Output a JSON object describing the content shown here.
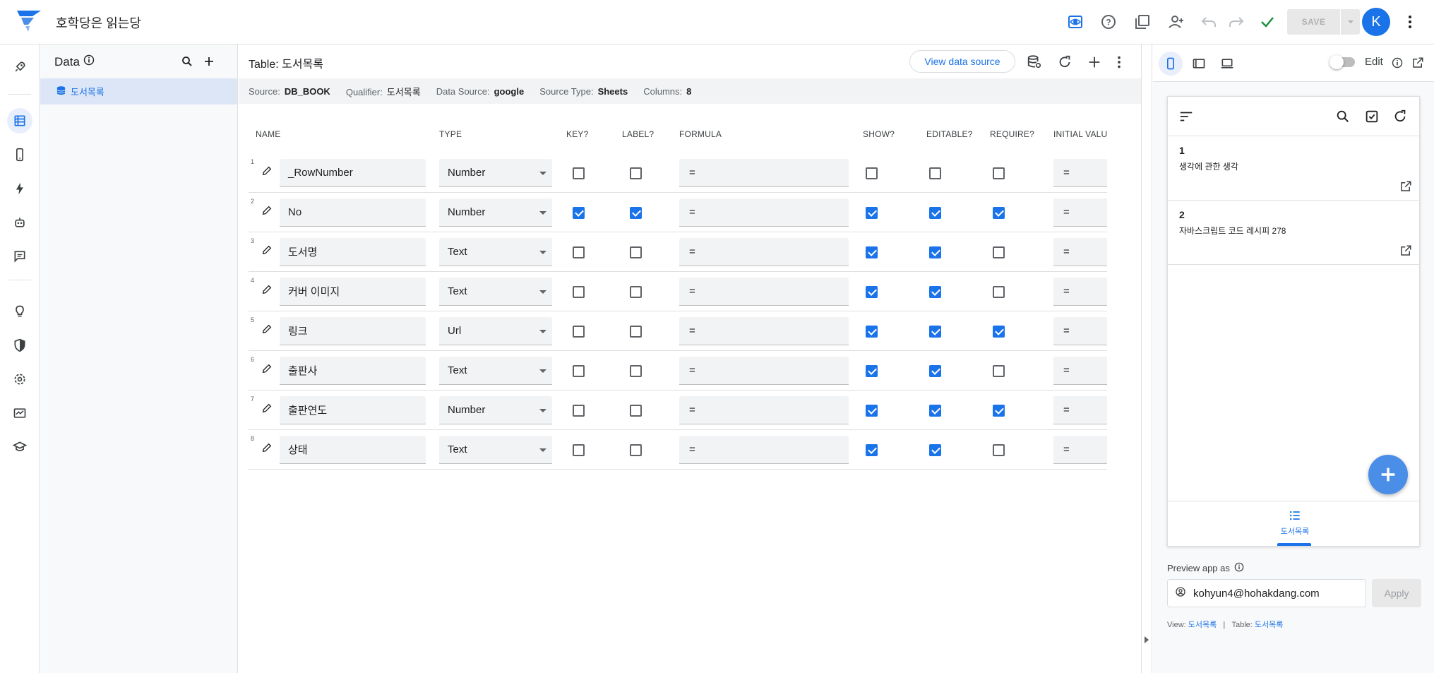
{
  "app": {
    "title": "호학당은 읽는당",
    "avatar_letter": "K",
    "save_label": "SAVE"
  },
  "colors": {
    "accent": "#1a73e8",
    "check_green": "#1e8e3e",
    "fab": "#4a8ee8"
  },
  "topbar_icons": [
    "preview-icon",
    "help-icon",
    "copy-app-icon",
    "share-icon",
    "undo-icon",
    "redo-icon",
    "check-icon",
    "more-vert-icon"
  ],
  "rail_icons": [
    "rocket-icon",
    "data-icon",
    "mobile-icon",
    "automation-icon",
    "bot-icon",
    "chat-icon",
    "lightbulb-icon",
    "security-icon",
    "settings-icon",
    "monitor-icon",
    "learn-icon"
  ],
  "data_panel": {
    "header": "Data",
    "tables": [
      "도서목록"
    ]
  },
  "main": {
    "title": "Table: 도서목록",
    "view_source_label": "View data source",
    "meta": [
      {
        "label": "Source:",
        "value": "DB_BOOK"
      },
      {
        "label": "Qualifier:",
        "value": "도서목록"
      },
      {
        "label": "Data Source:",
        "value": "google"
      },
      {
        "label": "Source Type:",
        "value": "Sheets"
      },
      {
        "label": "Columns:",
        "value": "8"
      }
    ],
    "columns": [
      "NAME",
      "TYPE",
      "KEY?",
      "LABEL?",
      "FORMULA",
      "SHOW?",
      "EDITABLE?",
      "REQUIRE?",
      "INITIAL VALUE"
    ],
    "rows": [
      {
        "num": "1",
        "name": "_RowNumber",
        "type": "Number",
        "key": false,
        "label": false,
        "formula": "=",
        "show": false,
        "editable": false,
        "require": false,
        "initial": "="
      },
      {
        "num": "2",
        "name": "No",
        "type": "Number",
        "key": true,
        "label": true,
        "formula": "=",
        "show": true,
        "editable": true,
        "require": true,
        "initial": "="
      },
      {
        "num": "3",
        "name": "도서명",
        "type": "Text",
        "key": false,
        "label": false,
        "formula": "=",
        "show": true,
        "editable": true,
        "require": false,
        "initial": "="
      },
      {
        "num": "4",
        "name": "커버 이미지",
        "type": "Text",
        "key": false,
        "label": false,
        "formula": "=",
        "show": true,
        "editable": true,
        "require": false,
        "initial": "="
      },
      {
        "num": "5",
        "name": "링크",
        "type": "Url",
        "key": false,
        "label": false,
        "formula": "=",
        "show": true,
        "editable": true,
        "require": true,
        "initial": "="
      },
      {
        "num": "6",
        "name": "출판사",
        "type": "Text",
        "key": false,
        "label": false,
        "formula": "=",
        "show": true,
        "editable": true,
        "require": false,
        "initial": "="
      },
      {
        "num": "7",
        "name": "출판연도",
        "type": "Number",
        "key": false,
        "label": false,
        "formula": "=",
        "show": true,
        "editable": true,
        "require": true,
        "initial": "="
      },
      {
        "num": "8",
        "name": "상태",
        "type": "Text",
        "key": false,
        "label": false,
        "formula": "=",
        "show": true,
        "editable": true,
        "require": false,
        "initial": "="
      }
    ]
  },
  "preview": {
    "edit_label": "Edit",
    "cards": [
      {
        "id": "1",
        "title": "생각에 관한 생각"
      },
      {
        "id": "2",
        "title": "자바스크립트 코드 레시피 278"
      }
    ],
    "nav_tab": "도서목록",
    "preview_as_label": "Preview app as",
    "email": "kohyun4@hohakdang.com",
    "apply_label": "Apply",
    "footer": {
      "view_label": "View:",
      "view_value": "도서목록",
      "sep": "|",
      "table_label": "Table:",
      "table_value": "도서목록"
    }
  }
}
